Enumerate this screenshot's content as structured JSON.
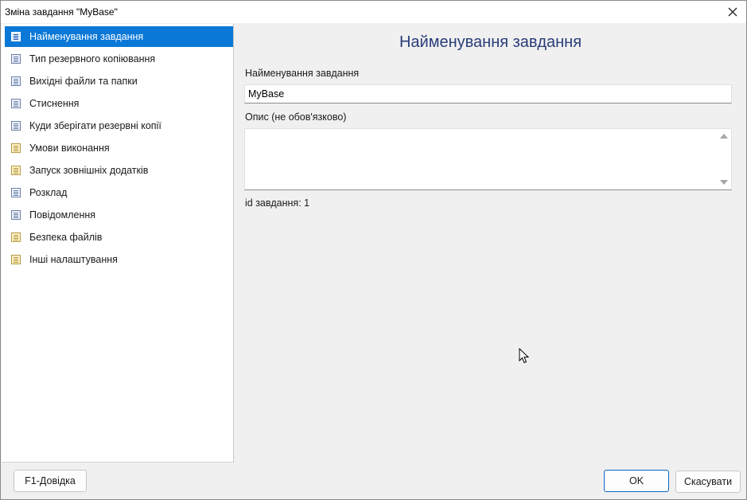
{
  "window": {
    "title": "Зміна завдання \"MyBase\"",
    "close_icon": "close-icon"
  },
  "sidebar": {
    "items": [
      {
        "label": "Найменування завдання",
        "icon": "document-icon",
        "selected": true
      },
      {
        "label": "Тип резервного копіювання",
        "icon": "document-icon"
      },
      {
        "label": "Вихідні файли та папки",
        "icon": "document-icon"
      },
      {
        "label": "Стиснення",
        "icon": "document-icon"
      },
      {
        "label": "Куди зберігати резервні копії",
        "icon": "document-icon"
      },
      {
        "label": "Умови виконання",
        "icon": "note-icon"
      },
      {
        "label": "Запуск зовнішніх додатків",
        "icon": "note-icon"
      },
      {
        "label": "Розклад",
        "icon": "document-icon"
      },
      {
        "label": "Повідомлення",
        "icon": "document-icon"
      },
      {
        "label": "Безпека файлів",
        "icon": "note-icon"
      },
      {
        "label": "Інші налаштування",
        "icon": "note-icon"
      }
    ]
  },
  "main": {
    "page_title": "Найменування завдання",
    "name_label": "Найменування завдання",
    "name_value": "MyBase",
    "description_label": "Опис (не обов'язково)",
    "description_value": "",
    "task_id_text": "id завдання: 1"
  },
  "footer": {
    "help_label": "F1-Довідка",
    "ok_label": "OK",
    "cancel_label": "Скасувати"
  },
  "colors": {
    "selection": "#0a78d7",
    "title_text": "#283c78",
    "ok_border": "#0a64c8"
  }
}
